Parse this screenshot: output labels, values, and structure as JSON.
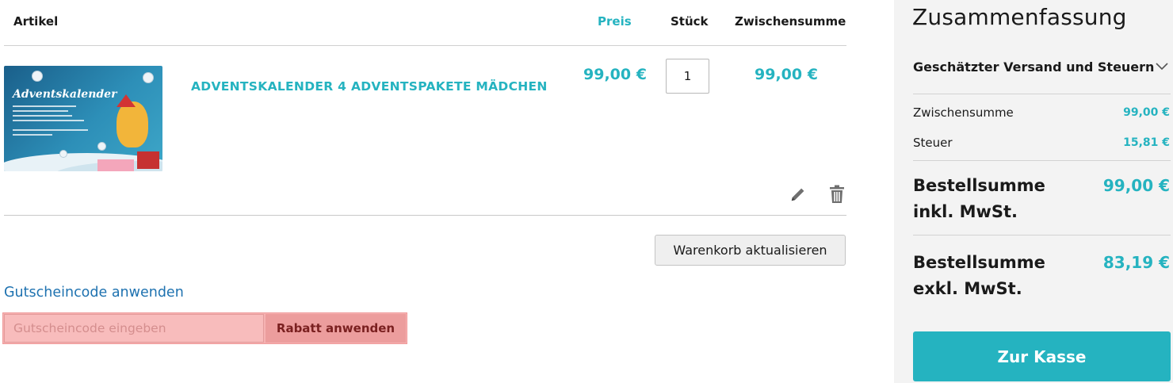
{
  "table": {
    "headers": {
      "artikel": "Artikel",
      "preis": "Preis",
      "stueck": "Stück",
      "zwischensumme": "Zwischensumme"
    }
  },
  "item": {
    "image_title": "Adventskalender",
    "name": "ADVENTSKALENDER 4 ADVENTSPAKETE MÄDCHEN",
    "price": "99,00 €",
    "quantity": "1",
    "subtotal": "99,00 €",
    "edit_icon": "pencil-icon",
    "delete_icon": "trash-icon"
  },
  "actions": {
    "update_cart": "Warenkorb aktualisieren"
  },
  "coupon": {
    "link": "Gutscheincode anwenden",
    "placeholder": "Gutscheincode eingeben",
    "button": "Rabatt anwenden"
  },
  "summary": {
    "title": "Zusammenfassung",
    "shipping_label": "Geschätzter Versand und Steuern",
    "rows": [
      {
        "label": "Zwischensumme",
        "value": "99,00 €"
      },
      {
        "label": "Steuer",
        "value": "15,81 €"
      }
    ],
    "totals": [
      {
        "label": "Bestellsumme inkl. MwSt.",
        "value": "99,00 €"
      },
      {
        "label": "Bestellsumme exkl. MwSt.",
        "value": "83,19 €"
      }
    ],
    "checkout": "Zur Kasse"
  },
  "colors": {
    "accent": "#25b3c0",
    "link": "#1e72b0",
    "coupon_highlight": "#f6b2b2"
  }
}
